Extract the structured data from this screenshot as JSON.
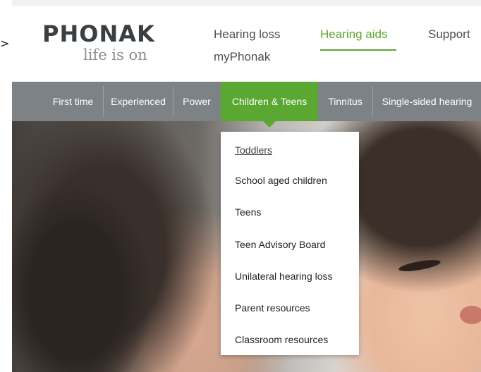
{
  "cursor": {
    "glyph": ">"
  },
  "brand": {
    "logo_word": "PHONAK",
    "tagline": "life is on"
  },
  "topnav": {
    "items": [
      {
        "label": "Hearing loss",
        "active": false
      },
      {
        "label": "Hearing aids",
        "active": true
      },
      {
        "label": "Support",
        "active": false
      },
      {
        "label": "myPhonak",
        "active": false
      }
    ]
  },
  "category_nav": {
    "items": [
      {
        "label": "First time",
        "active": false
      },
      {
        "label": "Experienced",
        "active": false
      },
      {
        "label": "Power",
        "active": false
      },
      {
        "label": "Children & Teens",
        "active": true
      },
      {
        "label": "Tinnitus",
        "active": false
      },
      {
        "label": "Single-sided hearing",
        "active": false
      }
    ]
  },
  "dropdown": {
    "items": [
      {
        "label": "Toddlers",
        "current": true
      },
      {
        "label": "School aged children",
        "current": false
      },
      {
        "label": "Teens",
        "current": false
      },
      {
        "label": "Teen Advisory Board",
        "current": false
      },
      {
        "label": "Unilateral hearing loss",
        "current": false
      },
      {
        "label": "Parent resources",
        "current": false
      },
      {
        "label": "Classroom resources",
        "current": false
      }
    ]
  },
  "colors": {
    "brand_green": "#5aa732",
    "nav_gray": "#7c8286",
    "text_dark": "#4a4f54"
  }
}
